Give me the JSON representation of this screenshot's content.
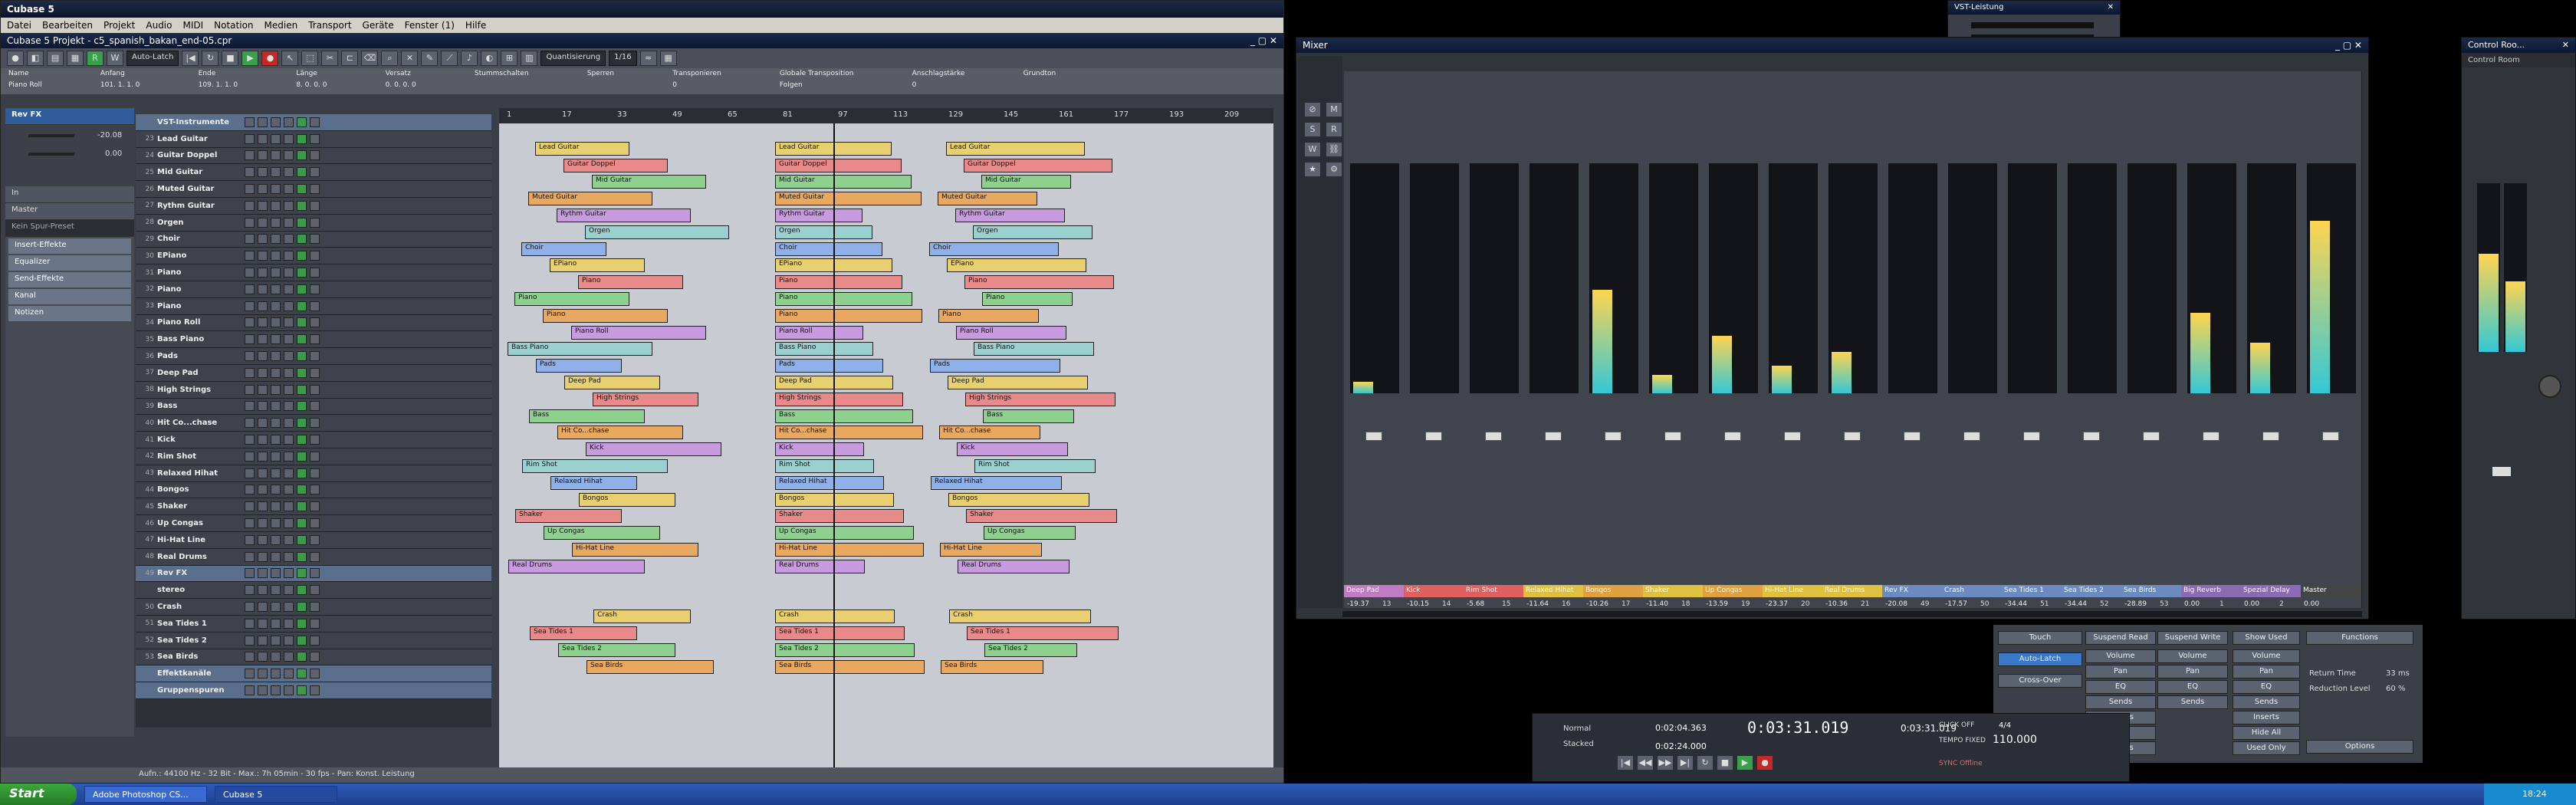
{
  "app": {
    "title": "Cubase 5"
  },
  "menu": [
    "Datei",
    "Bearbeiten",
    "Projekt",
    "Audio",
    "MIDI",
    "Notation",
    "Medien",
    "Transport",
    "Geräte",
    "Fenster (1)",
    "Hilfe"
  ],
  "project": {
    "window_title": "Cubase 5 Projekt - c5_spanish_bakan_end-05.cpr",
    "toolbar": {
      "automation": "Auto-Latch",
      "quantize_mode": "Quantisierung",
      "quantize_value": "1/16"
    },
    "infoline": {
      "labels": [
        "Name",
        "Anfang",
        "Ende",
        "Länge",
        "Versatz",
        "Stummschalten",
        "Sperren",
        "Transponieren",
        "Globale Transposition",
        "Anschlagstärke",
        "Grundton"
      ],
      "values": [
        "Piano Roll",
        "101. 1. 1. 0",
        "109. 1. 1. 0",
        "8. 0. 0. 0",
        "0. 0. 0. 0",
        "",
        "",
        "0",
        "Folgen",
        "0",
        ""
      ]
    },
    "inspector": {
      "track_name": "Rev FX",
      "input": "In",
      "output": "Master",
      "preset": "Kein Spur-Preset",
      "volume": "-20.08",
      "pan": "0.00",
      "sections": [
        "Insert-Effekte",
        "Equalizer",
        "Send-Effekte",
        "Kanal",
        "Notizen"
      ]
    },
    "ruler": [
      "1",
      "17",
      "33",
      "49",
      "65",
      "81",
      "97",
      "113",
      "129",
      "145",
      "161",
      "177",
      "193",
      "209"
    ],
    "tracks": [
      {
        "n": "",
        "name": "VST-Instrumente",
        "folder": true
      },
      {
        "n": "23",
        "name": "Lead Guitar"
      },
      {
        "n": "24",
        "name": "Guitar Doppel"
      },
      {
        "n": "25",
        "name": "Mid Guitar"
      },
      {
        "n": "26",
        "name": "Muted Guitar"
      },
      {
        "n": "27",
        "name": "Rythm Guitar"
      },
      {
        "n": "28",
        "name": "Orgen"
      },
      {
        "n": "29",
        "name": "Choir"
      },
      {
        "n": "30",
        "name": "EPiano"
      },
      {
        "n": "31",
        "name": "Piano"
      },
      {
        "n": "32",
        "name": "Piano"
      },
      {
        "n": "33",
        "name": "Piano"
      },
      {
        "n": "34",
        "name": "Piano Roll"
      },
      {
        "n": "35",
        "name": "Bass Piano"
      },
      {
        "n": "36",
        "name": "Pads"
      },
      {
        "n": "37",
        "name": "Deep Pad"
      },
      {
        "n": "38",
        "name": "High Strings"
      },
      {
        "n": "39",
        "name": "Bass"
      },
      {
        "n": "40",
        "name": "Hit Co...chase"
      },
      {
        "n": "41",
        "name": "Kick"
      },
      {
        "n": "42",
        "name": "Rim Shot"
      },
      {
        "n": "43",
        "name": "Relaxed Hihat"
      },
      {
        "n": "44",
        "name": "Bongos"
      },
      {
        "n": "45",
        "name": "Shaker"
      },
      {
        "n": "46",
        "name": "Up Congas"
      },
      {
        "n": "47",
        "name": "Hi-Hat Line"
      },
      {
        "n": "48",
        "name": "Real Drums"
      },
      {
        "n": "49",
        "name": "Rev FX",
        "folder": true
      },
      {
        "n": "",
        "name": "stereo"
      },
      {
        "n": "50",
        "name": "Crash"
      },
      {
        "n": "51",
        "name": "Sea Tides 1"
      },
      {
        "n": "52",
        "name": "Sea Tides 2"
      },
      {
        "n": "53",
        "name": "Sea Birds"
      },
      {
        "n": "",
        "name": "Effektkanäle",
        "folder": true
      },
      {
        "n": "",
        "name": "Gruppenspuren",
        "folder": true
      }
    ],
    "status": "Aufn.: 44100 Hz - 32 Bit - Max.: 7h 05min - 30 fps - Pan: Konst. Leistung"
  },
  "mixer": {
    "title": "Mixer",
    "strips": [
      {
        "name": "Deep Pad",
        "num": "13",
        "db": "-19.37",
        "level": 0.05,
        "color": "#c07cc0"
      },
      {
        "name": "Kick",
        "num": "14",
        "db": "-10.15",
        "level": 0.0,
        "color": "#e06060"
      },
      {
        "name": "Rim Shot",
        "num": "15",
        "db": "-5.68",
        "level": 0.0,
        "color": "#e06060"
      },
      {
        "name": "Relaxed Hihat",
        "num": "16",
        "db": "-11.64",
        "level": 0.0,
        "color": "#e0c040"
      },
      {
        "name": "Bongos",
        "num": "17",
        "db": "-10.26",
        "level": 0.45,
        "color": "#e0a040"
      },
      {
        "name": "Shaker",
        "num": "18",
        "db": "-11.40",
        "level": 0.08,
        "color": "#e0c040"
      },
      {
        "name": "Up Congas",
        "num": "19",
        "db": "-13.59",
        "level": 0.25,
        "color": "#e0a040"
      },
      {
        "name": "Hi-Hat Line",
        "num": "20",
        "db": "-23.37",
        "level": 0.12,
        "color": "#e0c040"
      },
      {
        "name": "Real Drums",
        "num": "21",
        "db": "-10.36",
        "level": 0.18,
        "color": "#e0c040"
      },
      {
        "name": "Rev FX",
        "num": "49",
        "db": "-20.08",
        "level": 0.0,
        "color": "#6a8ac0"
      },
      {
        "name": "Crash",
        "num": "50",
        "db": "-17.57",
        "level": 0.0,
        "color": "#6a8ac0"
      },
      {
        "name": "Sea Tides 1",
        "num": "51",
        "db": "-34.44",
        "level": 0.0,
        "color": "#6a8ac0"
      },
      {
        "name": "Sea Tides 2",
        "num": "52",
        "db": "-34.44",
        "level": 0.0,
        "color": "#6a8ac0"
      },
      {
        "name": "Sea Birds",
        "num": "53",
        "db": "-28.89",
        "level": 0.0,
        "color": "#6a8ac0"
      },
      {
        "name": "Big Reverb",
        "num": "1",
        "db": "0.00",
        "level": 0.35,
        "color": "#8a6ab0"
      },
      {
        "name": "Spezial Delay",
        "num": "2",
        "db": "0.00",
        "level": 0.22,
        "color": "#8a6ab0"
      },
      {
        "name": "Master",
        "num": "",
        "db": "0.00",
        "level": 0.75,
        "color": "#444"
      }
    ]
  },
  "vst": {
    "title": "VST-Leistung"
  },
  "control_room": {
    "title": "Control Roo...",
    "label": "Control Room"
  },
  "transport": {
    "position": "0:03:31.019",
    "left": "0:02:04.363",
    "right": "0:02:24.000",
    "secondary": "0:03:31.019",
    "tempo": "110.000",
    "signature": "4/4",
    "mode1": "Normal",
    "mode2": "Stacked",
    "click": "CLICK OFF",
    "tempo_label": "TEMPO FIXED",
    "sync": "SYNC Offline"
  },
  "commands": {
    "touch": "Touch",
    "latch": "Auto-Latch",
    "cross": "Cross-Over",
    "suspend_read": "Suspend Read",
    "suspend_write": "Suspend Write",
    "show_used": "Show Used",
    "functions": "Functions",
    "options": "Options",
    "return_time": "Return Time",
    "return_val": "33 ms",
    "reduction": "Reduction Level",
    "reduction_val": "60 %",
    "col1": [
      "Volume",
      "Pan",
      "EQ",
      "Sends"
    ],
    "col2": [
      "Volume",
      "Pan",
      "EQ",
      "Sends"
    ],
    "col3": [
      "Volume",
      "Pan",
      "EQ",
      "Sends",
      "Inserts",
      "Hide All",
      "Used Only"
    ],
    "extra": [
      "Inserts",
      "Mute",
      "Others"
    ]
  },
  "taskbar": {
    "start": "Start",
    "tasks": [
      "Adobe Photoshop CS...",
      "Cubase 5"
    ],
    "clock": "18:24"
  }
}
